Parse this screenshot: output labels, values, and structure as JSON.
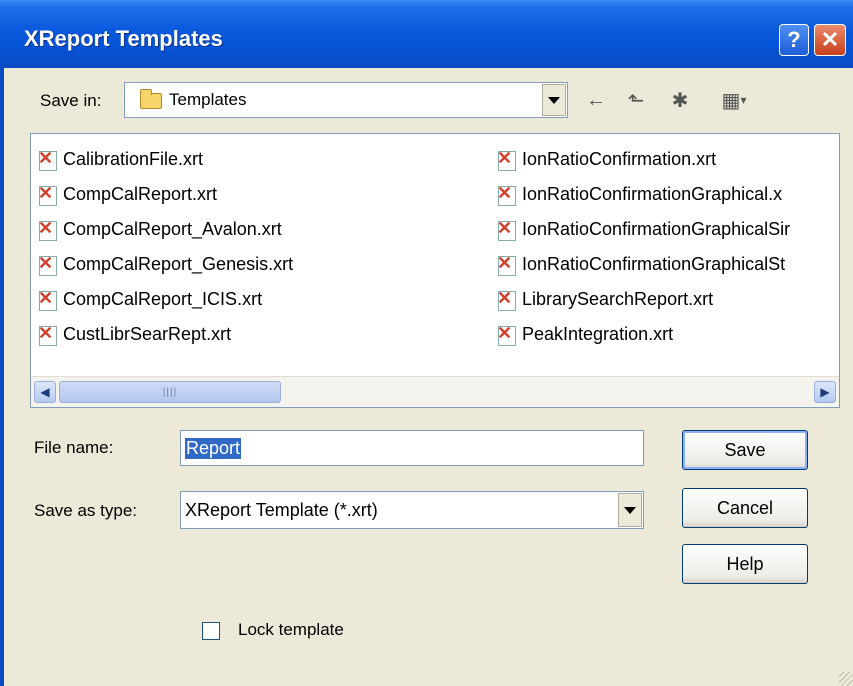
{
  "window": {
    "title": "XReport Templates"
  },
  "title_buttons": {
    "help": "?",
    "close": "✕"
  },
  "save_in": {
    "label": "Save in:",
    "value": "Templates"
  },
  "files": {
    "left": [
      "CalibrationFile.xrt",
      "CompCalReport.xrt",
      "CompCalReport_Avalon.xrt",
      "CompCalReport_Genesis.xrt",
      "CompCalReport_ICIS.xrt",
      "CustLibrSearRept.xrt"
    ],
    "right": [
      "IonRatioConfirmation.xrt",
      "IonRatioConfirmationGraphical.x",
      "IonRatioConfirmationGraphicalSir",
      "IonRatioConfirmationGraphicalSt",
      "LibrarySearchReport.xrt",
      "PeakIntegration.xrt"
    ]
  },
  "file_name": {
    "label": "File name:",
    "value": "Report"
  },
  "save_as_type": {
    "label": "Save as type:",
    "value": "XReport Template (*.xrt)"
  },
  "buttons": {
    "save": "Save",
    "cancel": "Cancel",
    "help": "Help"
  },
  "lock_template": {
    "label": "Lock template",
    "checked": false
  },
  "icons": {
    "back": "←",
    "up": "⬑",
    "new_folder": "✱",
    "views": "▦"
  }
}
